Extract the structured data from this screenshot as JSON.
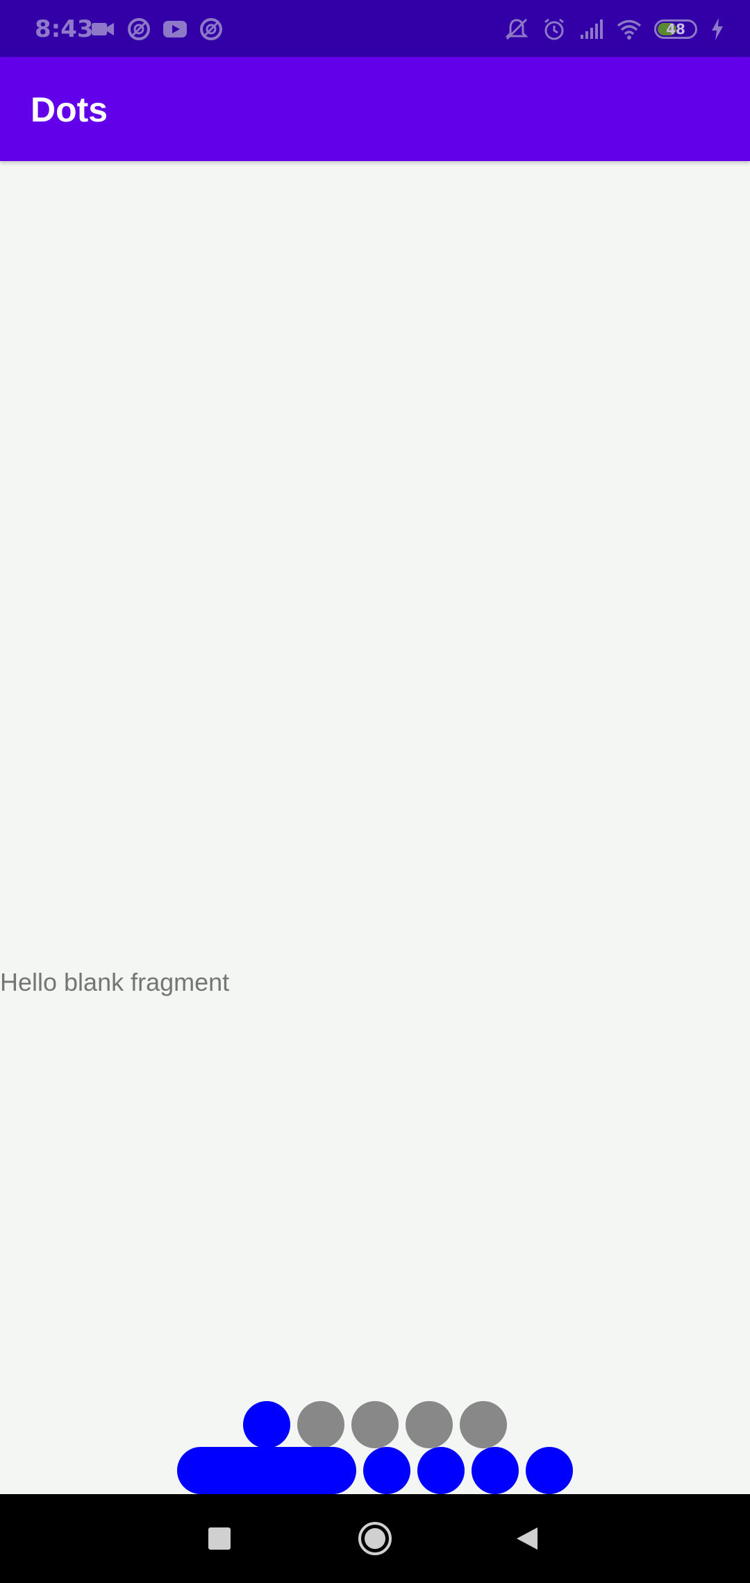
{
  "status_bar": {
    "time": "8:43",
    "battery_percent": "48",
    "battery_level": 0.48,
    "left_icons": [
      "video-camera-icon",
      "sync-icon",
      "youtube-icon",
      "sync-icon"
    ],
    "right_icons": [
      "vibrate-off-icon",
      "alarm-icon",
      "signal-icon",
      "wifi-icon",
      "battery-icon",
      "charging-icon"
    ],
    "background": "#3200a6"
  },
  "app_bar": {
    "title": "Dots",
    "background": "#6200ea"
  },
  "content": {
    "fragment_text": "Hello blank fragment",
    "background": "#f4f6f4"
  },
  "dots_indicators": {
    "row_1": {
      "count": 5,
      "selected_index": 0,
      "selected_color": "#0000ff",
      "unselected_color": "#888888"
    },
    "row_2": {
      "count": 5,
      "selected_index": 0,
      "selected_color": "#0000ff",
      "unselected_color": "#0000ff",
      "selected_style": "stretched"
    }
  },
  "nav_bar": {
    "buttons": [
      "recents-button",
      "home-button",
      "back-button"
    ],
    "background": "#000000"
  }
}
